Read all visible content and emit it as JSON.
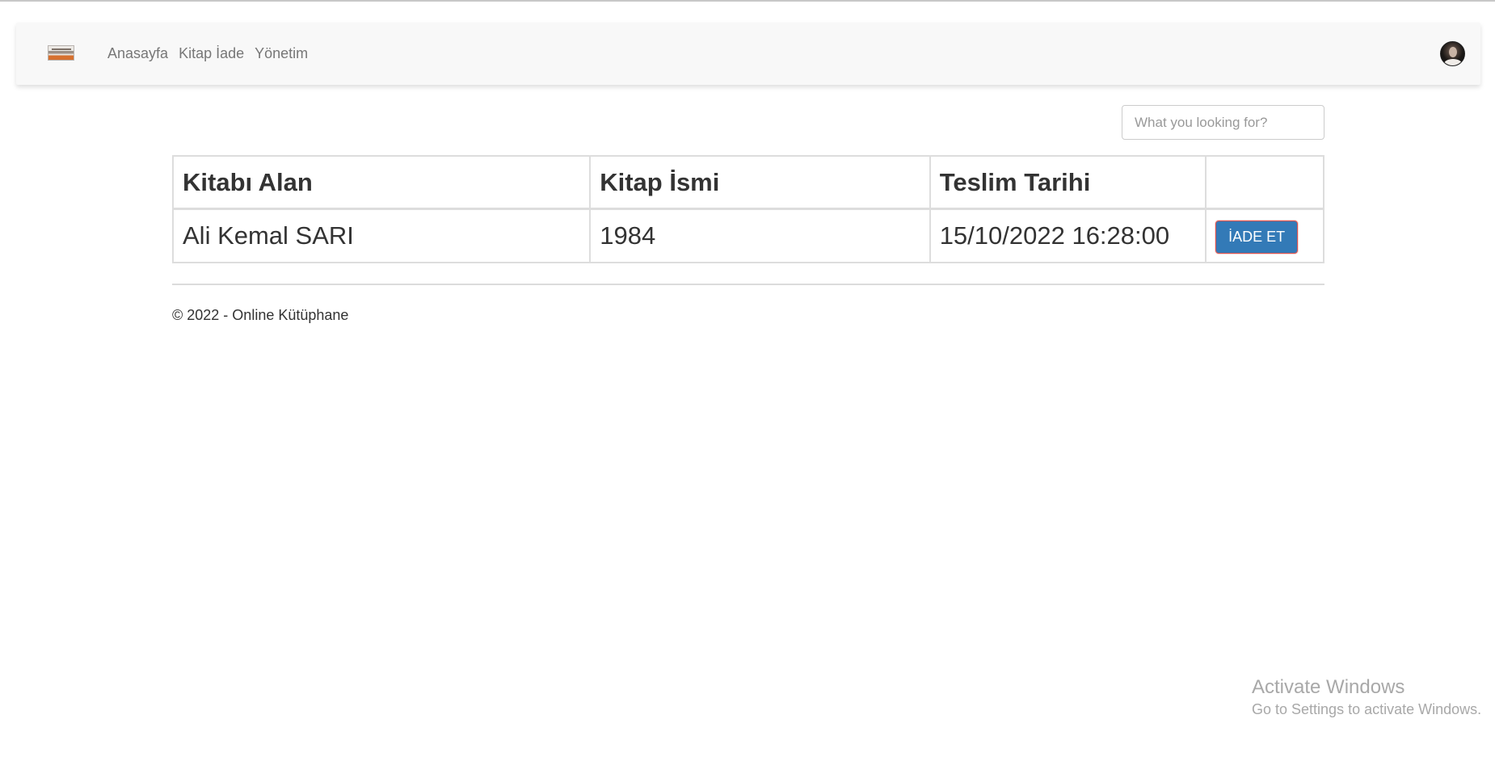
{
  "navbar": {
    "links": [
      {
        "label": "Anasayfa"
      },
      {
        "label": "Kitap İade"
      },
      {
        "label": "Yönetim"
      }
    ]
  },
  "search": {
    "placeholder": "What you looking for?",
    "value": ""
  },
  "table": {
    "headers": [
      "Kitabı Alan",
      "Kitap İsmi",
      "Teslim Tarihi",
      ""
    ],
    "rows": [
      {
        "borrower": "Ali Kemal SARI",
        "book": "1984",
        "due_date": "15/10/2022 16:28:00",
        "action_label": "İADE ET"
      }
    ]
  },
  "footer": {
    "text": "© 2022 - Online Kütüphane"
  },
  "windows_watermark": {
    "title": "Activate Windows",
    "subtitle": "Go to Settings to activate Windows."
  },
  "colors": {
    "navbar_bg": "#f8f8f8",
    "primary_button": "#337ab7",
    "button_border": "#d9534f",
    "table_border": "#dddddd"
  },
  "icons": {
    "brand": "library-photo-logo",
    "user": "user-avatar"
  }
}
